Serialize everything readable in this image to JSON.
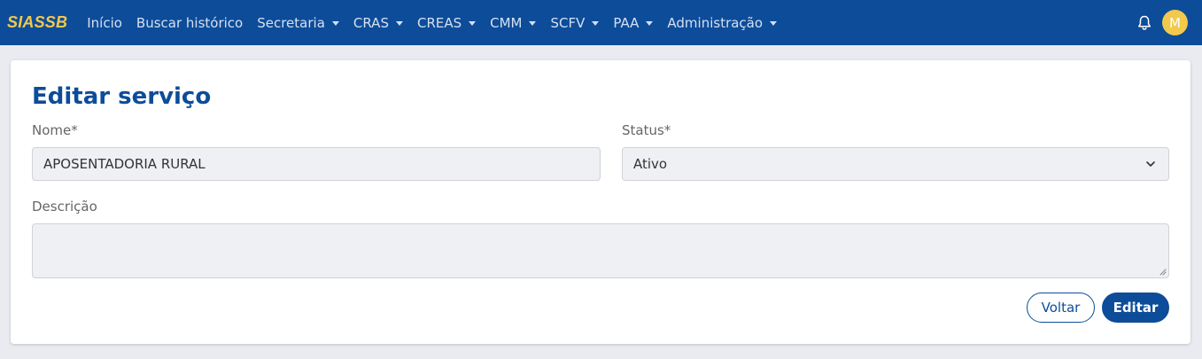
{
  "navbar": {
    "brand": "SIASSB",
    "items": [
      {
        "label": "Início",
        "dropdown": false
      },
      {
        "label": "Buscar histórico",
        "dropdown": false
      },
      {
        "label": "Secretaria",
        "dropdown": true
      },
      {
        "label": "CRAS",
        "dropdown": true
      },
      {
        "label": "CREAS",
        "dropdown": true
      },
      {
        "label": "CMM",
        "dropdown": true
      },
      {
        "label": "SCFV",
        "dropdown": true
      },
      {
        "label": "PAA",
        "dropdown": true
      },
      {
        "label": "Administração",
        "dropdown": true
      }
    ],
    "notification_icon": "bell-icon",
    "avatar_initial": "M"
  },
  "form": {
    "title": "Editar serviço",
    "nome_label": "Nome*",
    "nome_value": "APOSENTADORIA RURAL",
    "status_label": "Status*",
    "status_value": "Ativo",
    "descricao_label": "Descrição",
    "descricao_value": "",
    "back_label": "Voltar",
    "submit_label": "Editar"
  },
  "colors": {
    "primary": "#0d4c99",
    "brand_accent": "#f2c94c",
    "input_bg": "#eff0f3",
    "page_bg": "#e9ebf0"
  }
}
